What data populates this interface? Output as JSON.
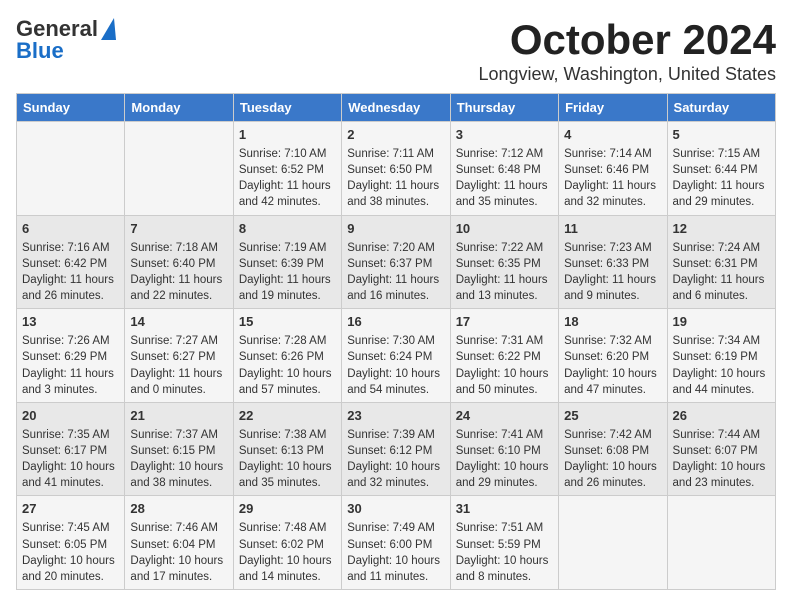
{
  "header": {
    "logo_line1": "General",
    "logo_line2": "Blue",
    "title": "October 2024",
    "subtitle": "Longview, Washington, United States"
  },
  "days_of_week": [
    "Sunday",
    "Monday",
    "Tuesday",
    "Wednesday",
    "Thursday",
    "Friday",
    "Saturday"
  ],
  "weeks": [
    [
      {
        "day": "",
        "sunrise": "",
        "sunset": "",
        "daylight": ""
      },
      {
        "day": "",
        "sunrise": "",
        "sunset": "",
        "daylight": ""
      },
      {
        "day": "1",
        "sunrise": "Sunrise: 7:10 AM",
        "sunset": "Sunset: 6:52 PM",
        "daylight": "Daylight: 11 hours and 42 minutes."
      },
      {
        "day": "2",
        "sunrise": "Sunrise: 7:11 AM",
        "sunset": "Sunset: 6:50 PM",
        "daylight": "Daylight: 11 hours and 38 minutes."
      },
      {
        "day": "3",
        "sunrise": "Sunrise: 7:12 AM",
        "sunset": "Sunset: 6:48 PM",
        "daylight": "Daylight: 11 hours and 35 minutes."
      },
      {
        "day": "4",
        "sunrise": "Sunrise: 7:14 AM",
        "sunset": "Sunset: 6:46 PM",
        "daylight": "Daylight: 11 hours and 32 minutes."
      },
      {
        "day": "5",
        "sunrise": "Sunrise: 7:15 AM",
        "sunset": "Sunset: 6:44 PM",
        "daylight": "Daylight: 11 hours and 29 minutes."
      }
    ],
    [
      {
        "day": "6",
        "sunrise": "Sunrise: 7:16 AM",
        "sunset": "Sunset: 6:42 PM",
        "daylight": "Daylight: 11 hours and 26 minutes."
      },
      {
        "day": "7",
        "sunrise": "Sunrise: 7:18 AM",
        "sunset": "Sunset: 6:40 PM",
        "daylight": "Daylight: 11 hours and 22 minutes."
      },
      {
        "day": "8",
        "sunrise": "Sunrise: 7:19 AM",
        "sunset": "Sunset: 6:39 PM",
        "daylight": "Daylight: 11 hours and 19 minutes."
      },
      {
        "day": "9",
        "sunrise": "Sunrise: 7:20 AM",
        "sunset": "Sunset: 6:37 PM",
        "daylight": "Daylight: 11 hours and 16 minutes."
      },
      {
        "day": "10",
        "sunrise": "Sunrise: 7:22 AM",
        "sunset": "Sunset: 6:35 PM",
        "daylight": "Daylight: 11 hours and 13 minutes."
      },
      {
        "day": "11",
        "sunrise": "Sunrise: 7:23 AM",
        "sunset": "Sunset: 6:33 PM",
        "daylight": "Daylight: 11 hours and 9 minutes."
      },
      {
        "day": "12",
        "sunrise": "Sunrise: 7:24 AM",
        "sunset": "Sunset: 6:31 PM",
        "daylight": "Daylight: 11 hours and 6 minutes."
      }
    ],
    [
      {
        "day": "13",
        "sunrise": "Sunrise: 7:26 AM",
        "sunset": "Sunset: 6:29 PM",
        "daylight": "Daylight: 11 hours and 3 minutes."
      },
      {
        "day": "14",
        "sunrise": "Sunrise: 7:27 AM",
        "sunset": "Sunset: 6:27 PM",
        "daylight": "Daylight: 11 hours and 0 minutes."
      },
      {
        "day": "15",
        "sunrise": "Sunrise: 7:28 AM",
        "sunset": "Sunset: 6:26 PM",
        "daylight": "Daylight: 10 hours and 57 minutes."
      },
      {
        "day": "16",
        "sunrise": "Sunrise: 7:30 AM",
        "sunset": "Sunset: 6:24 PM",
        "daylight": "Daylight: 10 hours and 54 minutes."
      },
      {
        "day": "17",
        "sunrise": "Sunrise: 7:31 AM",
        "sunset": "Sunset: 6:22 PM",
        "daylight": "Daylight: 10 hours and 50 minutes."
      },
      {
        "day": "18",
        "sunrise": "Sunrise: 7:32 AM",
        "sunset": "Sunset: 6:20 PM",
        "daylight": "Daylight: 10 hours and 47 minutes."
      },
      {
        "day": "19",
        "sunrise": "Sunrise: 7:34 AM",
        "sunset": "Sunset: 6:19 PM",
        "daylight": "Daylight: 10 hours and 44 minutes."
      }
    ],
    [
      {
        "day": "20",
        "sunrise": "Sunrise: 7:35 AM",
        "sunset": "Sunset: 6:17 PM",
        "daylight": "Daylight: 10 hours and 41 minutes."
      },
      {
        "day": "21",
        "sunrise": "Sunrise: 7:37 AM",
        "sunset": "Sunset: 6:15 PM",
        "daylight": "Daylight: 10 hours and 38 minutes."
      },
      {
        "day": "22",
        "sunrise": "Sunrise: 7:38 AM",
        "sunset": "Sunset: 6:13 PM",
        "daylight": "Daylight: 10 hours and 35 minutes."
      },
      {
        "day": "23",
        "sunrise": "Sunrise: 7:39 AM",
        "sunset": "Sunset: 6:12 PM",
        "daylight": "Daylight: 10 hours and 32 minutes."
      },
      {
        "day": "24",
        "sunrise": "Sunrise: 7:41 AM",
        "sunset": "Sunset: 6:10 PM",
        "daylight": "Daylight: 10 hours and 29 minutes."
      },
      {
        "day": "25",
        "sunrise": "Sunrise: 7:42 AM",
        "sunset": "Sunset: 6:08 PM",
        "daylight": "Daylight: 10 hours and 26 minutes."
      },
      {
        "day": "26",
        "sunrise": "Sunrise: 7:44 AM",
        "sunset": "Sunset: 6:07 PM",
        "daylight": "Daylight: 10 hours and 23 minutes."
      }
    ],
    [
      {
        "day": "27",
        "sunrise": "Sunrise: 7:45 AM",
        "sunset": "Sunset: 6:05 PM",
        "daylight": "Daylight: 10 hours and 20 minutes."
      },
      {
        "day": "28",
        "sunrise": "Sunrise: 7:46 AM",
        "sunset": "Sunset: 6:04 PM",
        "daylight": "Daylight: 10 hours and 17 minutes."
      },
      {
        "day": "29",
        "sunrise": "Sunrise: 7:48 AM",
        "sunset": "Sunset: 6:02 PM",
        "daylight": "Daylight: 10 hours and 14 minutes."
      },
      {
        "day": "30",
        "sunrise": "Sunrise: 7:49 AM",
        "sunset": "Sunset: 6:00 PM",
        "daylight": "Daylight: 10 hours and 11 minutes."
      },
      {
        "day": "31",
        "sunrise": "Sunrise: 7:51 AM",
        "sunset": "Sunset: 5:59 PM",
        "daylight": "Daylight: 10 hours and 8 minutes."
      },
      {
        "day": "",
        "sunrise": "",
        "sunset": "",
        "daylight": ""
      },
      {
        "day": "",
        "sunrise": "",
        "sunset": "",
        "daylight": ""
      }
    ]
  ]
}
